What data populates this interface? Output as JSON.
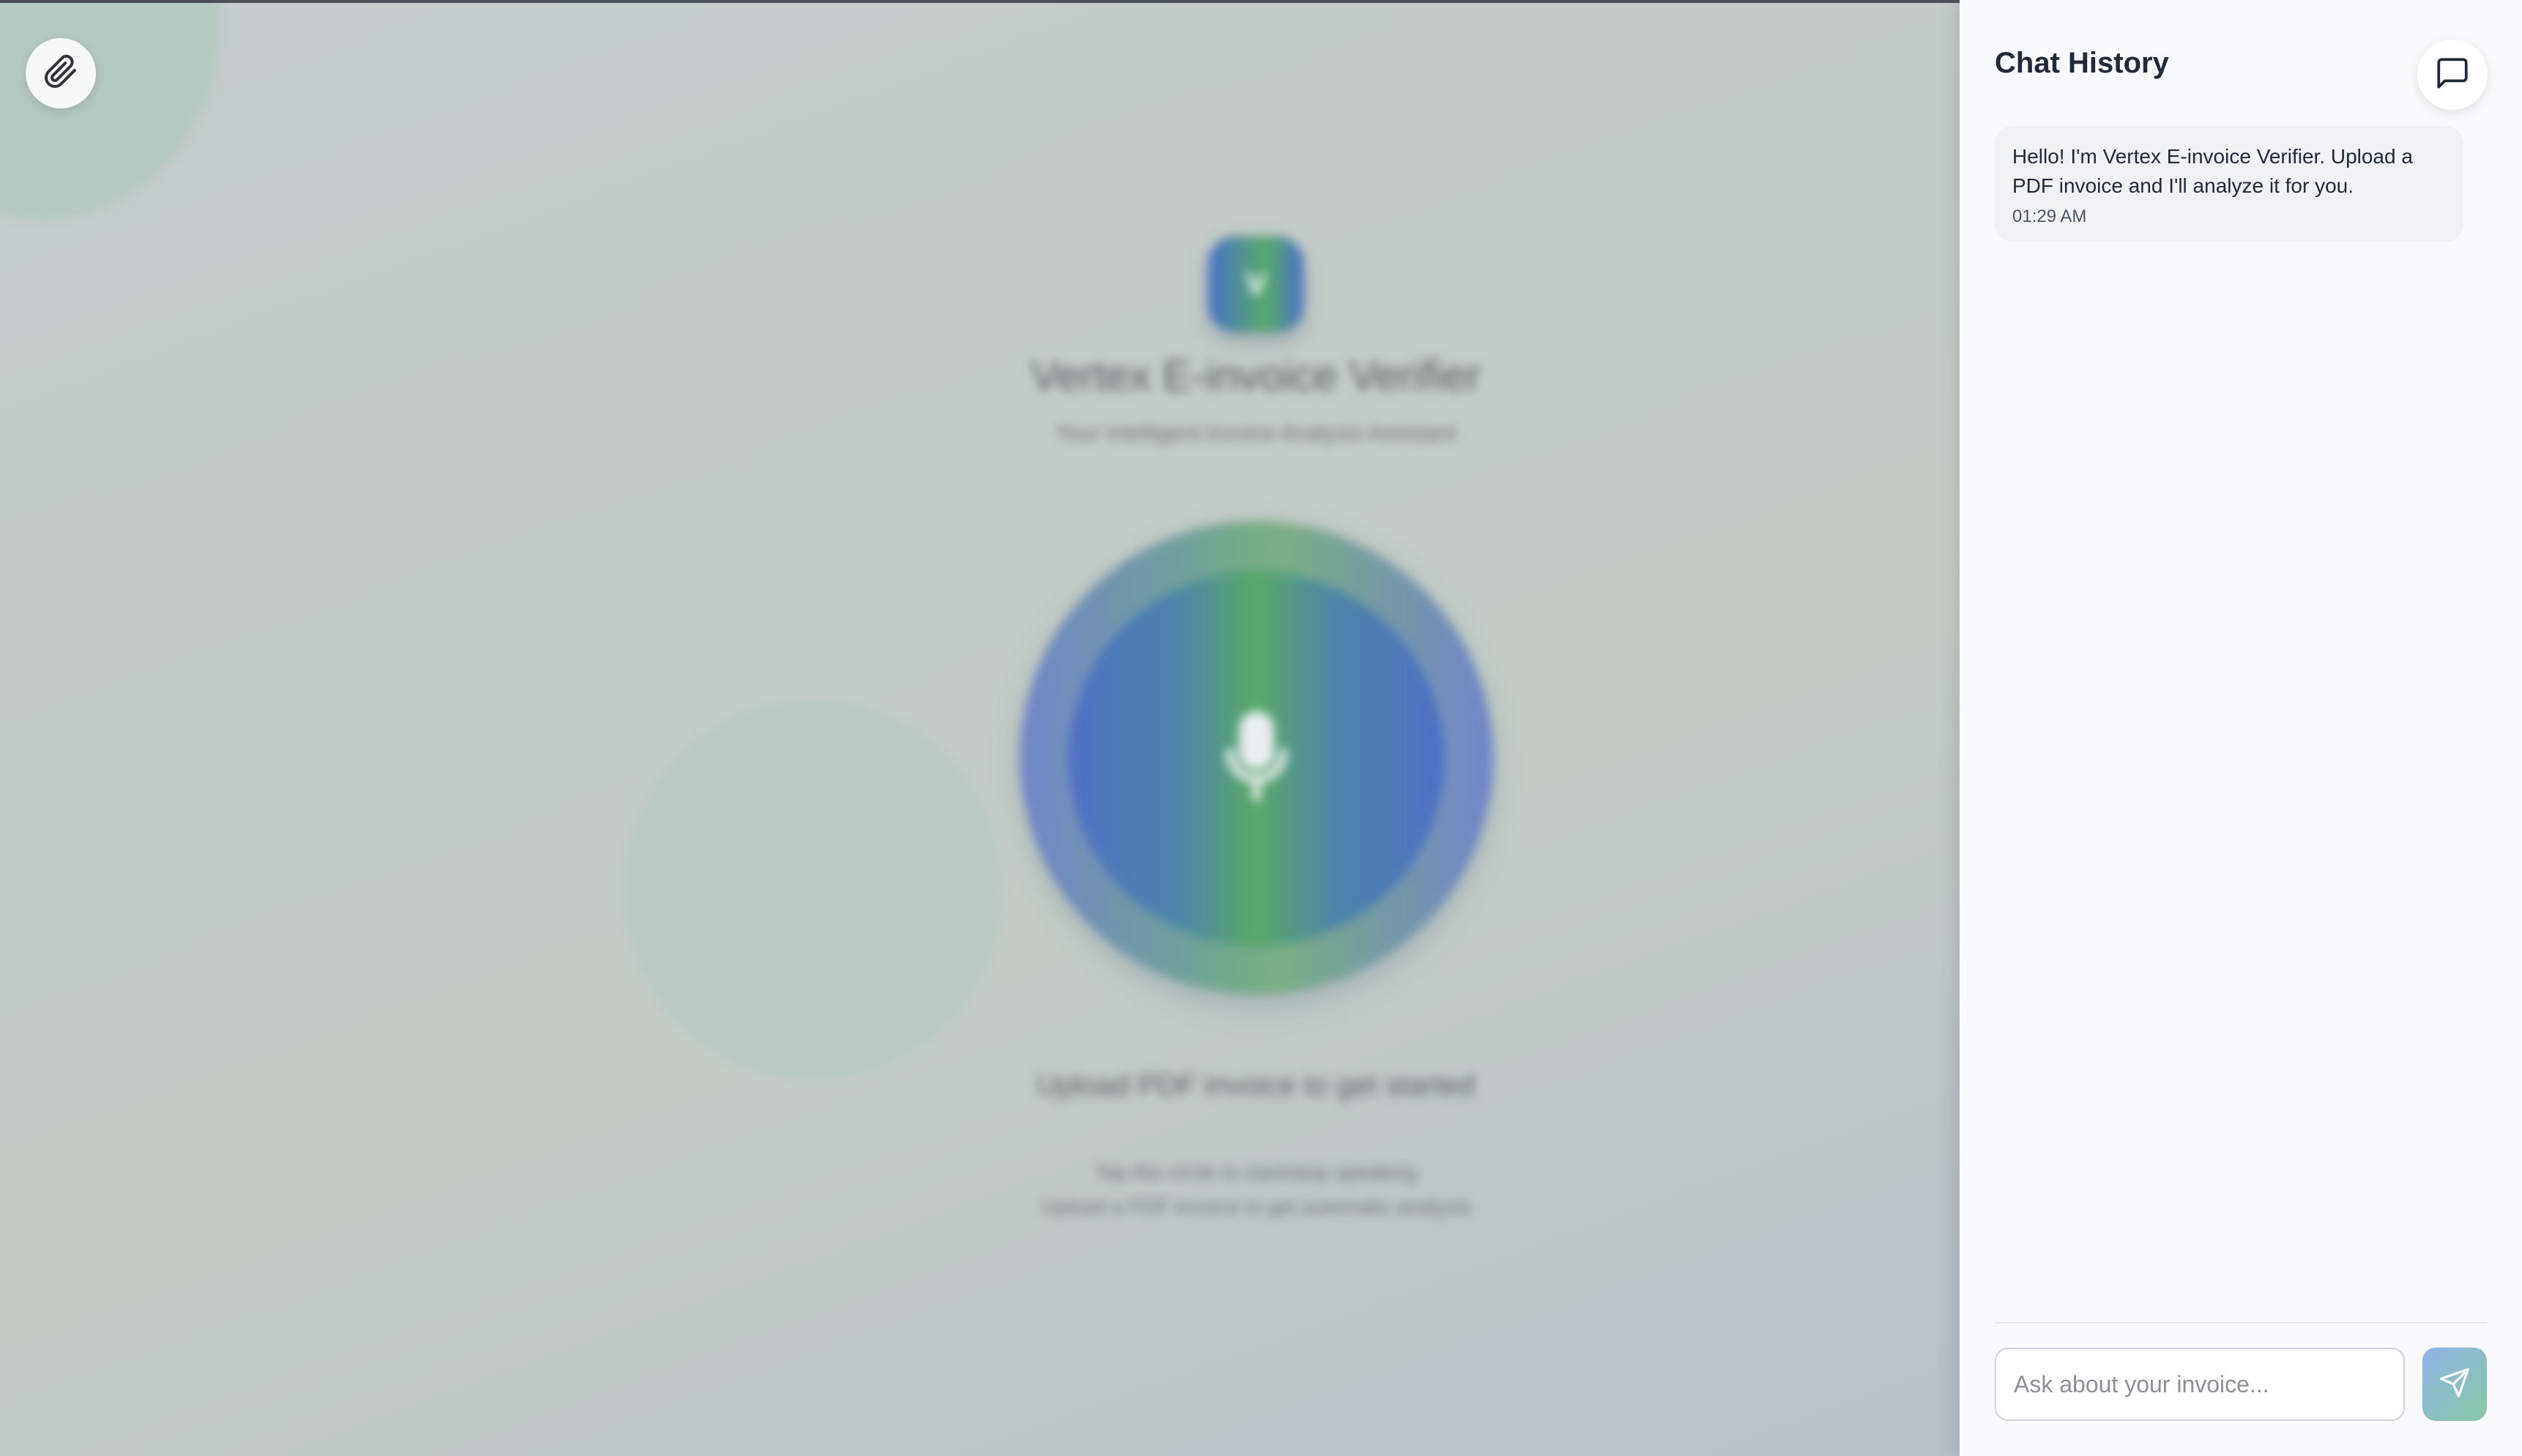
{
  "app": {
    "brand_initial": "V",
    "title": "Vertex E-invoice Verifier",
    "subtitle": "Your Intelligent Invoice Analysis Assistant",
    "status": "Upload PDF invoice to get started",
    "hint_line_1": "Tap the circle to start/stop speaking",
    "hint_line_2": "Upload a PDF invoice to get automatic analysis"
  },
  "toolbar": {
    "attach_icon": "paperclip-icon"
  },
  "sidebar": {
    "title": "Chat History",
    "toggle_icon": "chat-bubble-icon",
    "messages": [
      {
        "text": "Hello! I'm Vertex E-invoice Verifier. Upload a PDF invoice and I'll analyze it for you.",
        "time": "01:29 AM"
      }
    ],
    "input": {
      "value": "",
      "placeholder": "Ask about your invoice..."
    },
    "send_icon": "send-icon"
  },
  "colors": {
    "accent_blue": "#4d6fc6",
    "accent_green": "#58a866",
    "sidebar_bg": "#f9fafb"
  }
}
